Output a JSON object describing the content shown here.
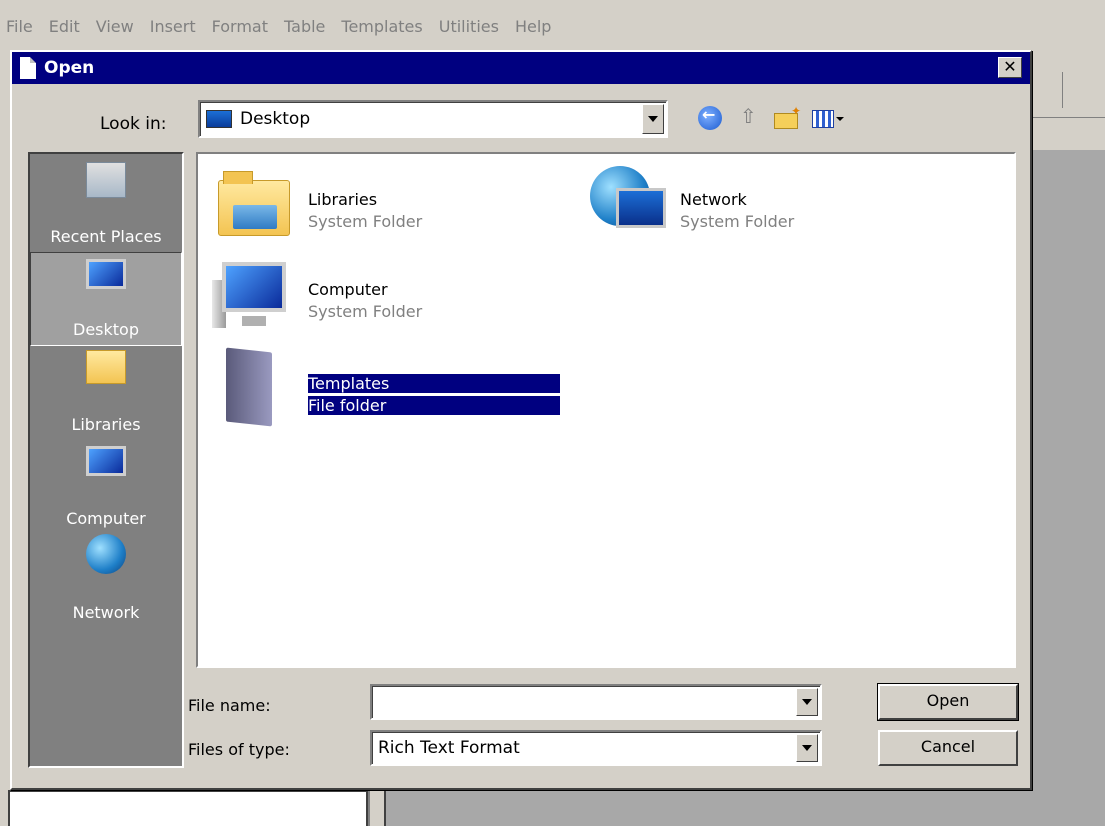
{
  "menubar": {
    "items": [
      "File",
      "Edit",
      "View",
      "Insert",
      "Format",
      "Table",
      "Templates",
      "Utilities",
      "Help"
    ]
  },
  "dialog": {
    "title": "Open",
    "close_label": "✕",
    "look_in_label": "Look in:",
    "look_in_value": "Desktop",
    "places": [
      {
        "label": "Recent Places",
        "icon": "recent-places-icon"
      },
      {
        "label": "Desktop",
        "icon": "desktop-icon",
        "selected": true
      },
      {
        "label": "Libraries",
        "icon": "libraries-icon"
      },
      {
        "label": "Computer",
        "icon": "computer-icon"
      },
      {
        "label": "Network",
        "icon": "network-icon"
      }
    ],
    "files": [
      {
        "name": "Libraries",
        "type": "System Folder",
        "icon": "libraries-folder-icon"
      },
      {
        "name": "Network",
        "type": "System Folder",
        "icon": "network-globe-icon"
      },
      {
        "name": "Computer",
        "type": "System Folder",
        "icon": "computer-icon"
      },
      {
        "name": "Templates",
        "type": "File folder",
        "icon": "templates-folder-icon",
        "selected": true
      }
    ],
    "file_name_label": "File name:",
    "file_name_value": "",
    "files_of_type_label": "Files of type:",
    "files_of_type_value": "Rich Text Format",
    "open_button": "Open",
    "cancel_button": "Cancel"
  },
  "colors": {
    "titlebar": "#000080",
    "selection": "#000080",
    "face": "#d4d0c8"
  }
}
